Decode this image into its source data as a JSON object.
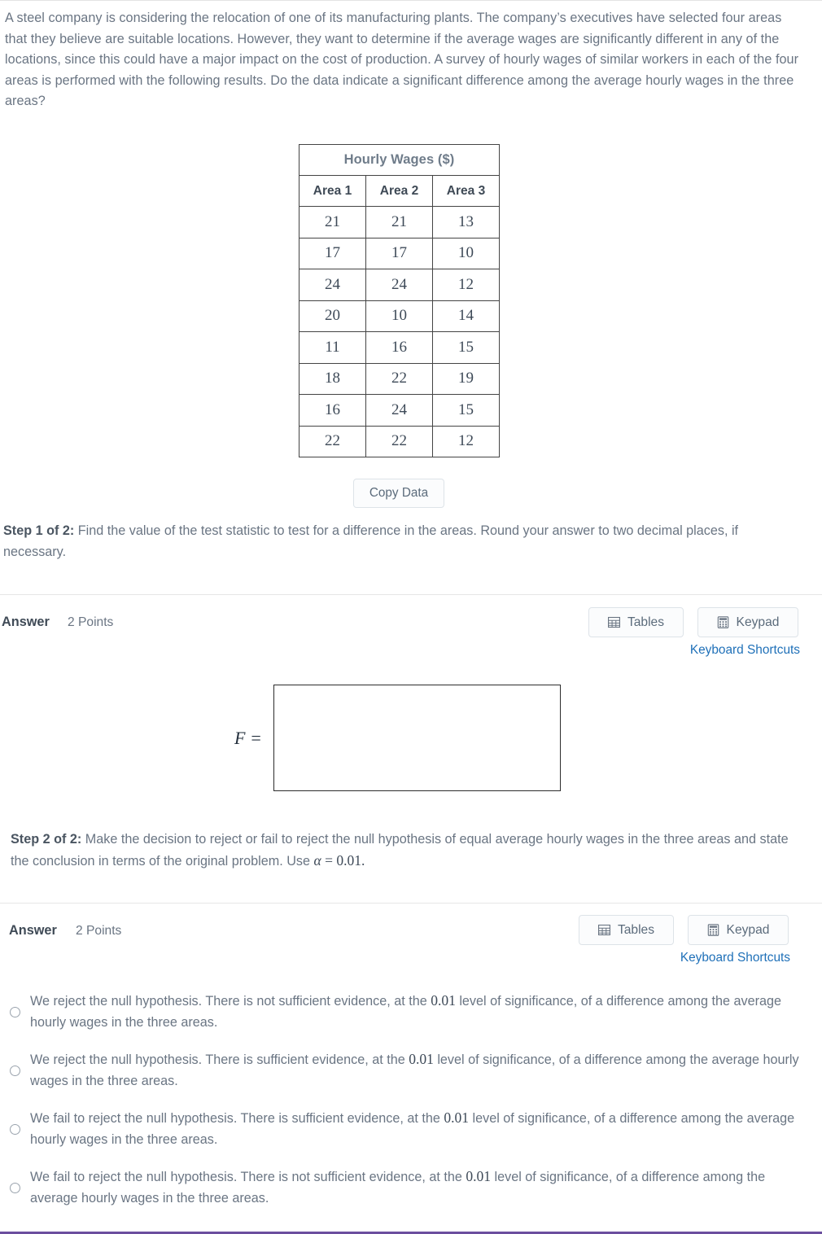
{
  "question": {
    "text": "A steel company is considering the relocation of one of its manufacturing plants. The company’s executives have selected four areas that they believe are suitable locations. However, they want to determine if the average wages are significantly different in any of the locations, since this could have a major impact on the cost of production. A survey of hourly wages of similar workers in each of the four areas is performed with the following results. Do the data indicate a significant difference among the average hourly wages in the three areas?"
  },
  "data_table": {
    "title": "Hourly Wages ($)",
    "columns": [
      "Area 1",
      "Area 2",
      "Area 3"
    ],
    "rows": [
      [
        "21",
        "21",
        "13"
      ],
      [
        "17",
        "17",
        "10"
      ],
      [
        "24",
        "24",
        "12"
      ],
      [
        "20",
        "10",
        "14"
      ],
      [
        "11",
        "16",
        "15"
      ],
      [
        "18",
        "22",
        "19"
      ],
      [
        "16",
        "24",
        "15"
      ],
      [
        "22",
        "22",
        "12"
      ]
    ]
  },
  "copy_data_button": {
    "label": "Copy Data"
  },
  "step1": {
    "label": "Step 1 of 2:",
    "text": " Find the value of the test statistic to test for a difference in the areas. Round your answer to two decimal places, if necessary."
  },
  "answer1": {
    "answer_label": "Answer",
    "points_label": "2 Points",
    "tables_button": "Tables",
    "keypad_button": "Keypad",
    "keyboard_shortcuts": "Keyboard Shortcuts",
    "f_label": "F =",
    "f_value": ""
  },
  "step2": {
    "label": "Step 2 of 2:",
    "text_part1": " Make the decision to reject or fail to reject the null hypothesis of equal average hourly wages in the three areas and state the conclusion in terms of the original problem. Use ",
    "alpha_symbol": "α",
    "equals": " = ",
    "alpha_value": "0.01",
    "period": "."
  },
  "answer2": {
    "answer_label": "Answer",
    "points_label": "2 Points",
    "tables_button": "Tables",
    "keypad_button": "Keypad",
    "keyboard_shortcuts": "Keyboard Shortcuts"
  },
  "choices": [
    {
      "part1": "We reject the null hypothesis. There is not sufficient evidence, at the ",
      "alpha": "0.01",
      "part2": " level of significance, of a difference among the average hourly wages in the three areas.",
      "selected": false
    },
    {
      "part1": "We reject the null hypothesis. There is sufficient evidence, at the ",
      "alpha": "0.01",
      "part2": " level of significance, of a difference among the average hourly wages in the three areas.",
      "selected": false
    },
    {
      "part1": "We fail to reject the null hypothesis. There is sufficient evidence, at the ",
      "alpha": "0.01",
      "part2": " level of significance, of a difference among the average hourly wages in the three areas.",
      "selected": false
    },
    {
      "part1": "We fail to reject the null hypothesis. There is not sufficient evidence, at the ",
      "alpha": "0.01",
      "part2": " level of significance, of a difference among the average hourly wages in the three areas.",
      "selected": false
    }
  ],
  "colors": {
    "link": "#1f70b8",
    "bottom_rule": "#6b4e9e",
    "text": "#6a7583",
    "table_border": "#444444"
  }
}
